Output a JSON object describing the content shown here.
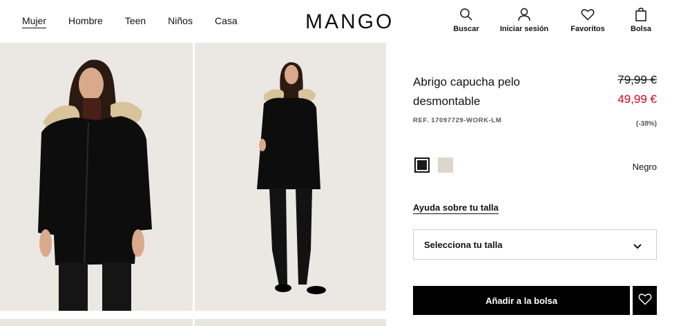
{
  "nav": {
    "items": [
      {
        "label": "Mujer",
        "active": true
      },
      {
        "label": "Hombre",
        "active": false
      },
      {
        "label": "Teen",
        "active": false
      },
      {
        "label": "Niños",
        "active": false
      },
      {
        "label": "Casa",
        "active": false
      }
    ]
  },
  "brand": {
    "logo_text": "MANGO"
  },
  "actions": {
    "search": "Buscar",
    "login": "Iniciar sesión",
    "favorites": "Favoritos",
    "bag": "Bolsa"
  },
  "product": {
    "title": "Abrigo capucha pelo desmontable",
    "price_original": "79,99 €",
    "price_sale": "49,99 €",
    "ref": "REF. 17097729-WORK-LM",
    "discount": "(-38%)",
    "colors": [
      {
        "name": "Negro",
        "hex": "#1a1a1a",
        "selected": true
      },
      {
        "name": "",
        "hex": "#ddd6cc",
        "selected": false
      }
    ],
    "selected_color": "Negro",
    "size_help": "Ayuda sobre tu talla",
    "size_placeholder": "Selecciona tu talla",
    "add_to_bag": "Añadir a la bolsa"
  },
  "colors": {
    "sale_red": "#e0001b",
    "button_bg": "#000000",
    "photo_bg": "#ebe7e3"
  },
  "icons": {
    "search": "search-icon",
    "login": "user-icon",
    "favorites": "heart-icon",
    "bag": "bag-icon",
    "size_dropdown": "chevron-down-icon",
    "wishlist": "heart-icon"
  }
}
